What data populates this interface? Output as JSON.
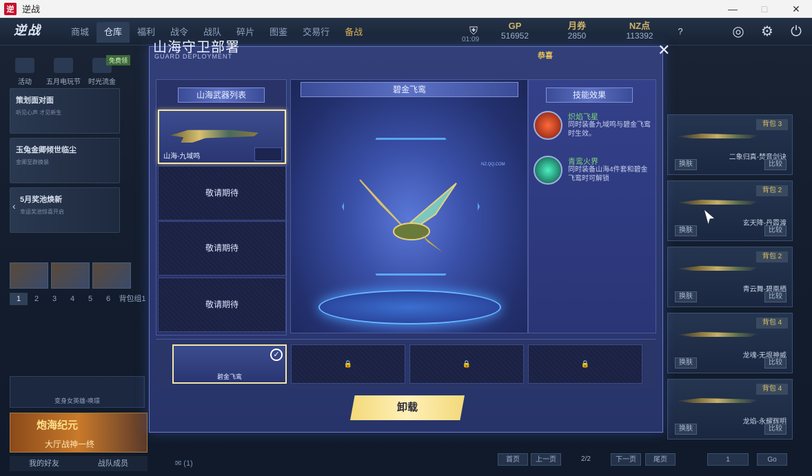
{
  "window": {
    "title": "逆战",
    "logo_text": "逆"
  },
  "topbar": {
    "logo": "逆战",
    "nav": [
      "商城",
      "仓库",
      "福利",
      "战令",
      "战队",
      "碎片",
      "图鉴",
      "交易行",
      "备战"
    ],
    "time": "01:09",
    "currencies": [
      {
        "label": "GP",
        "value": "516952"
      },
      {
        "label": "月券",
        "value": "2850"
      },
      {
        "label": "NZ点",
        "value": "113392"
      }
    ]
  },
  "left": {
    "quick": [
      "活动",
      "五月电玩节",
      "时光流金"
    ],
    "badge": "免费领",
    "promos": [
      {
        "title": "策划面对面",
        "sub": "听见心声 才见新生"
      },
      {
        "title": "玉兔金卿倾世临尘",
        "sub": "金卿至群换装"
      },
      {
        "title": "5月奖池焕新",
        "sub": "幸运奖池惊喜开启"
      }
    ],
    "pages": [
      "1",
      "2",
      "3",
      "4",
      "5",
      "6",
      "背包组1"
    ],
    "recruit": "变身女英雄-唤璟",
    "banner_title": "炮海纪元",
    "banner_sub": "大厅战神一终",
    "friends": [
      "我的好友",
      "战队成员"
    ],
    "mail": "(1)"
  },
  "modal": {
    "title": "山海守卫部署",
    "subtitle": "GUARD DEPLOYMENT",
    "congrats": "恭喜",
    "weapon_list_header": "山海武器列表",
    "weapons": [
      {
        "name": "山海-九域鸣",
        "selected": true
      },
      {
        "name": "敬请期待",
        "selected": false
      },
      {
        "name": "敬请期待",
        "selected": false
      },
      {
        "name": "敬请期待",
        "selected": false
      }
    ],
    "center_title": "碧金飞鸾",
    "watermark": "NZ.QQ.COM",
    "skills_header": "技能效果",
    "skills": [
      {
        "name": "炽焰飞星",
        "desc": "同时装备九域鸣与碧金飞鸾时生效。"
      },
      {
        "name": "青鸾火界",
        "desc": "同时装备山海4件套和碧金飞鸾时可解锁"
      }
    ],
    "equip_slots": [
      {
        "label": "碧金飞鸾",
        "selected": true
      },
      {
        "label": "",
        "selected": false
      },
      {
        "label": "",
        "selected": false
      },
      {
        "label": "",
        "selected": false
      }
    ],
    "unload_label": "卸载"
  },
  "inventory": [
    {
      "bag": "背包 3",
      "name": "二象归真-焚音剑诀"
    },
    {
      "bag": "背包 2",
      "name": "玄天降-丹霞渡"
    },
    {
      "bag": "背包 2",
      "name": "青云舞-碧凰栖"
    },
    {
      "bag": "背包 4",
      "name": "龙魂-无垠神威"
    },
    {
      "bag": "背包 4",
      "name": "龙焰-永耀辉明"
    }
  ],
  "inv_buttons": {
    "swap": "换肤",
    "compare": "比较"
  },
  "pager": {
    "first": "首页",
    "prev": "上一页",
    "info": "2/2",
    "next": "下一页",
    "last": "尾页",
    "page": "1",
    "go": "Go"
  }
}
